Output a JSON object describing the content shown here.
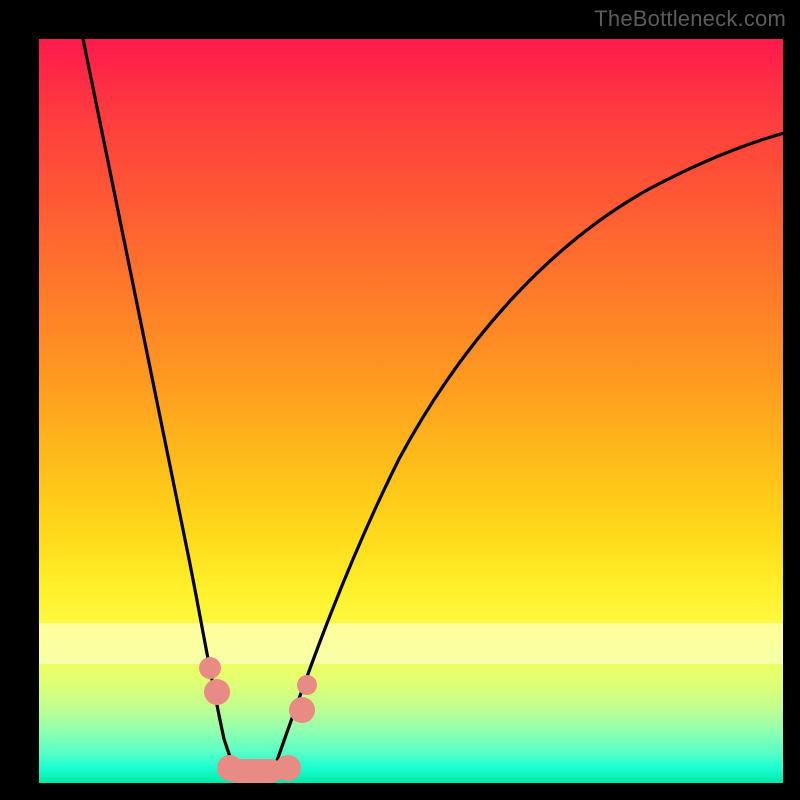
{
  "watermark": "TheBottleneck.com",
  "chart_data": {
    "type": "line",
    "title": "",
    "xlabel": "",
    "ylabel": "",
    "ylim": [
      0,
      100
    ],
    "xlim": [
      0,
      100
    ],
    "series": [
      {
        "name": "bottleneck-curve",
        "x": [
          0,
          5,
          10,
          15,
          20,
          23,
          25,
          27,
          29,
          31,
          35,
          40,
          50,
          60,
          70,
          80,
          90,
          100
        ],
        "values": [
          100,
          82,
          64,
          45,
          26,
          13,
          6,
          2,
          2,
          5,
          15,
          28,
          47,
          60,
          70,
          78,
          84,
          89
        ]
      }
    ],
    "markers": {
      "name": "highlight-points",
      "x": [
        22.0,
        22.5,
        25.5,
        28.0,
        30.5,
        31.0
      ],
      "values": [
        16,
        12,
        3,
        3,
        10,
        14
      ]
    }
  }
}
